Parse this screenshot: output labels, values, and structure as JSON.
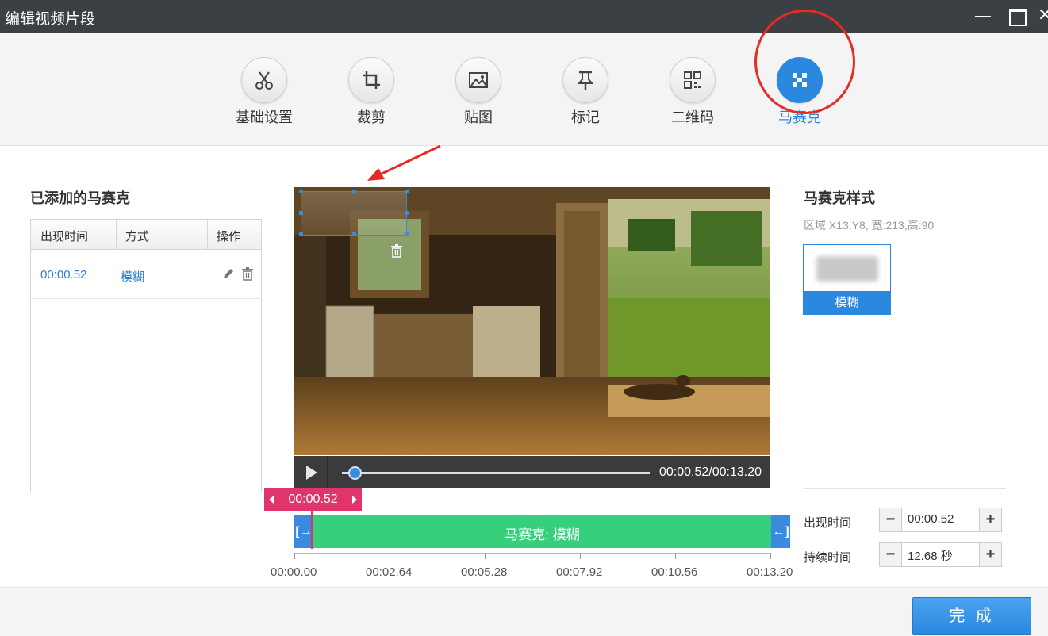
{
  "window": {
    "title": "编辑视频片段"
  },
  "toolbar": {
    "items": [
      {
        "label": "基础设置",
        "icon": "scissors-icon"
      },
      {
        "label": "裁剪",
        "icon": "crop-icon"
      },
      {
        "label": "贴图",
        "icon": "image-icon"
      },
      {
        "label": "标记",
        "icon": "pin-icon"
      },
      {
        "label": "二维码",
        "icon": "qrcode-icon"
      },
      {
        "label": "马赛克",
        "icon": "mosaic-icon",
        "active": true
      }
    ]
  },
  "left_panel": {
    "title": "已添加的马赛克",
    "columns": [
      "出现时间",
      "方式",
      "操作"
    ],
    "rows": [
      {
        "time": "00:00.52",
        "mode": "模糊"
      }
    ]
  },
  "player": {
    "timecode": "00:00.52/00:13.20",
    "progress": 0.04
  },
  "timeline": {
    "flag_time": "00:00.52",
    "clip_label": "马赛克: 模糊",
    "ticks": [
      "00:00.00",
      "00:02.64",
      "00:05.28",
      "00:07.92",
      "00:10.56",
      "00:13.20"
    ]
  },
  "right_panel": {
    "title": "马赛克样式",
    "region_info": "区域 X13,Y8,  宽:213,高:90",
    "style_option": "模糊",
    "appear_label": "出现时间",
    "appear_value": "00:00.52",
    "duration_label": "持续时间",
    "duration_value": "12.68 秒"
  },
  "footer": {
    "done_label": "完 成"
  },
  "colors": {
    "accent": "#2b88e0",
    "clip": "#36d07c",
    "flag": "#e0356a",
    "annotation": "#e52b24"
  }
}
